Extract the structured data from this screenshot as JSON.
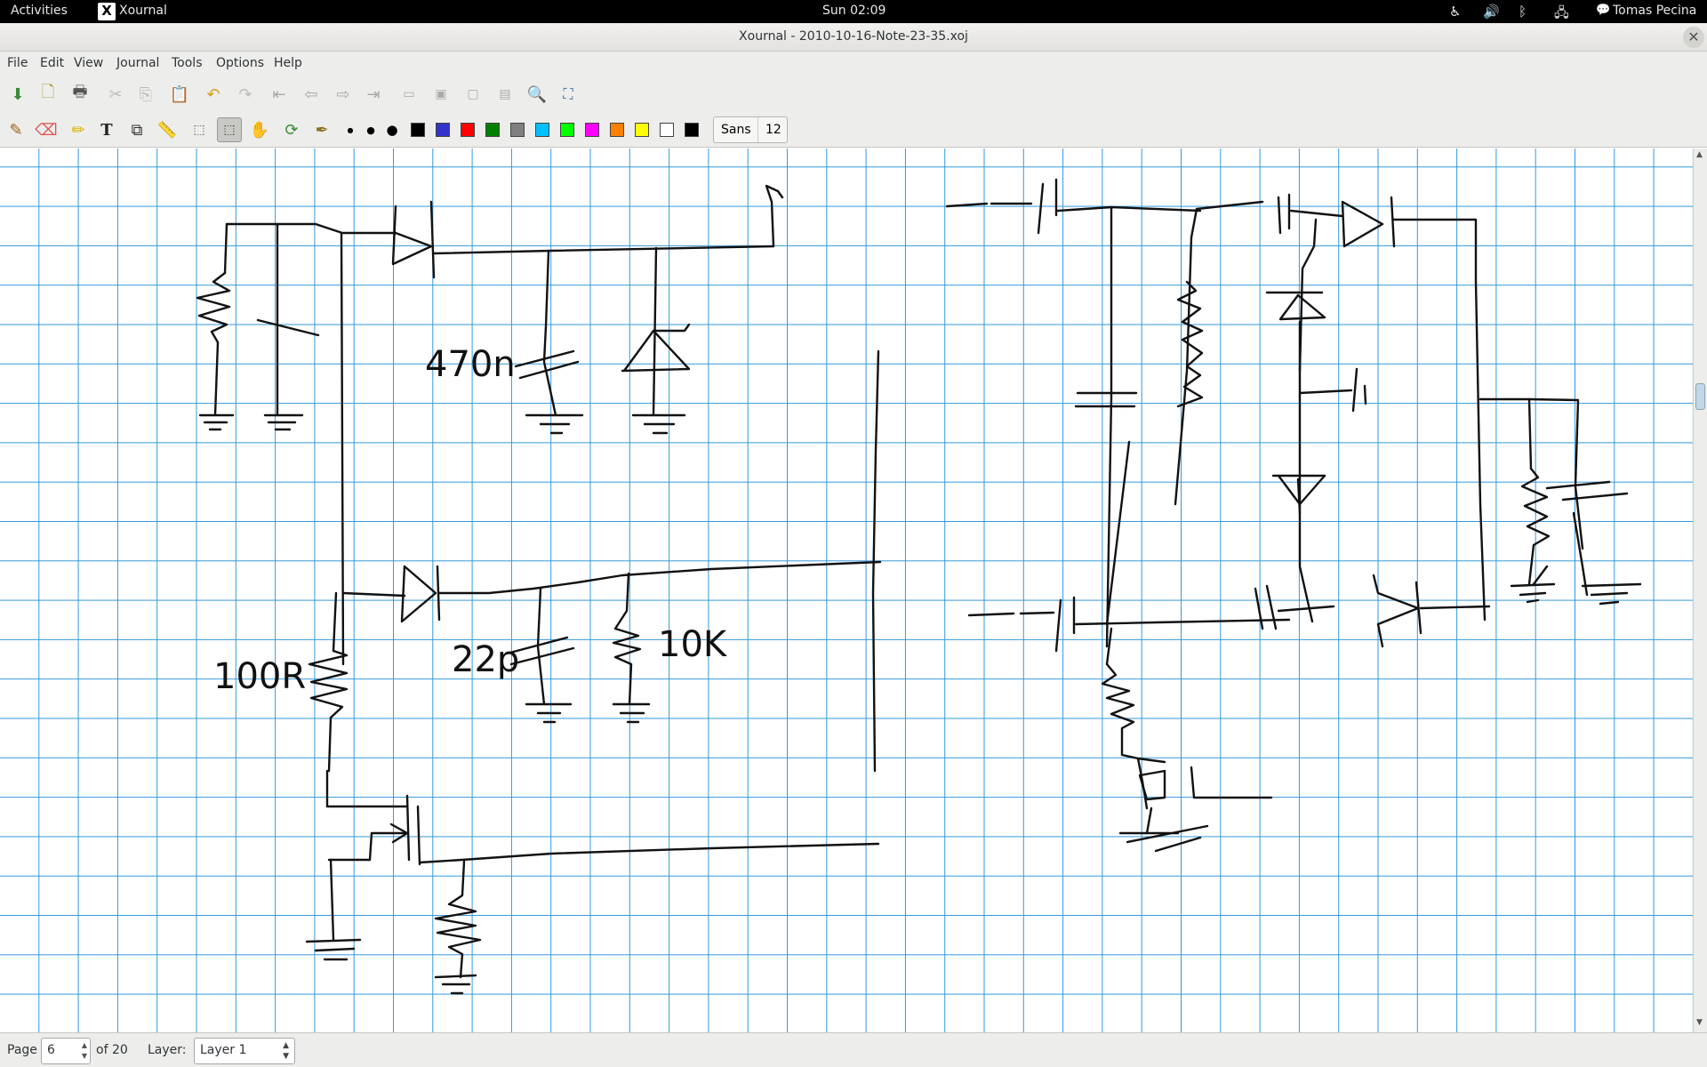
{
  "topbar": {
    "activities": "Activities",
    "app_name": "Xournal",
    "clock": "Sun 02:09",
    "user": "Tomas Pecina"
  },
  "window": {
    "title": "Xournal - 2010-10-16-Note-23-35.xoj"
  },
  "menu": [
    "File",
    "Edit",
    "View",
    "Journal",
    "Tools",
    "Options",
    "Help"
  ],
  "toolbar": {
    "font_name": "Sans",
    "font_size": "12",
    "colors": [
      "#000000",
      "#3333cc",
      "#ff0000",
      "#008000",
      "#808080",
      "#00c0ff",
      "#00ff00",
      "#ff00ff",
      "#ff8000",
      "#ffff00",
      "#ffffff"
    ]
  },
  "canvas": {
    "labels": [
      "470n",
      "22p",
      "10K",
      "100R"
    ],
    "grid_color": "#3399dd"
  },
  "statusbar": {
    "page_label": "Page",
    "page_value": "6",
    "page_of": "of 20",
    "layer_label": "Layer:",
    "layer_value": "Layer 1"
  }
}
